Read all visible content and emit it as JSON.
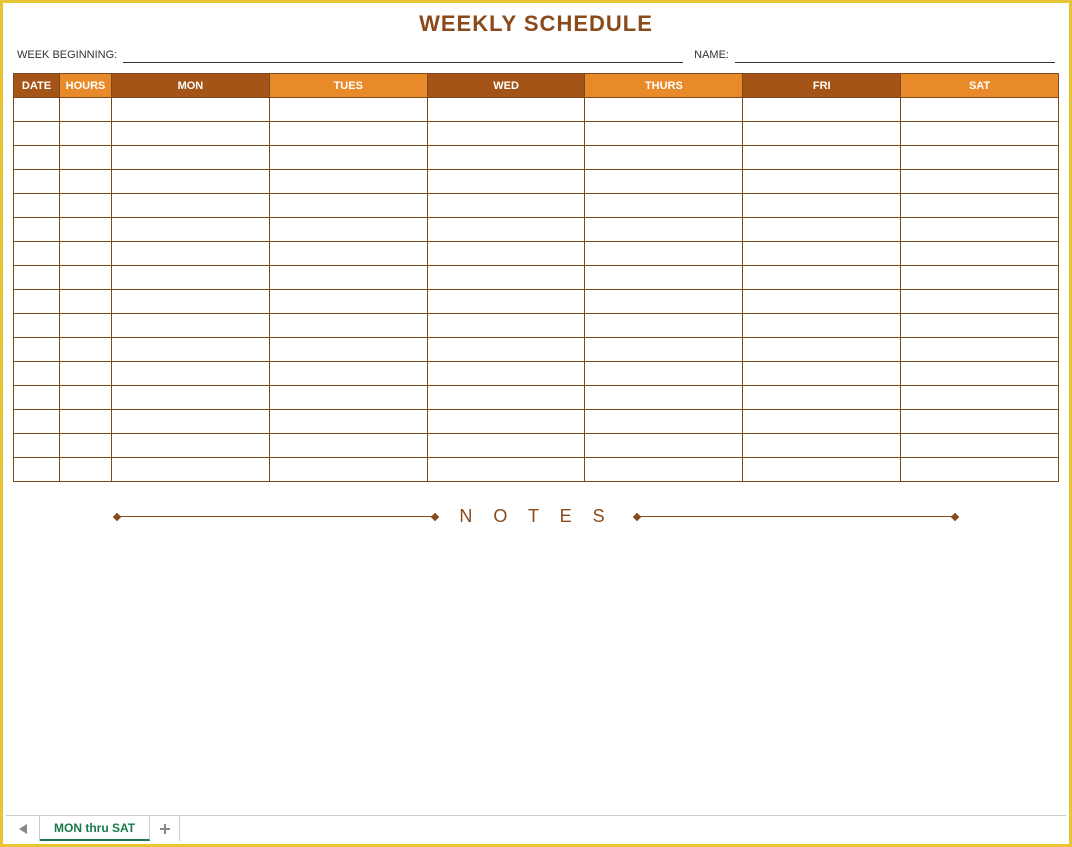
{
  "title": "WEEKLY SCHEDULE",
  "meta": {
    "week_beginning_label": "WEEK BEGINNING:",
    "week_beginning_value": "",
    "name_label": "NAME:",
    "name_value": ""
  },
  "headers": {
    "date": "DATE",
    "hours": "HOURS",
    "days": [
      "MON",
      "TUES",
      "WED",
      "THURS",
      "FRI",
      "SAT"
    ]
  },
  "rows": 16,
  "notes_label": "N O T E S",
  "sheet_tab": {
    "active": "MON thru SAT"
  }
}
